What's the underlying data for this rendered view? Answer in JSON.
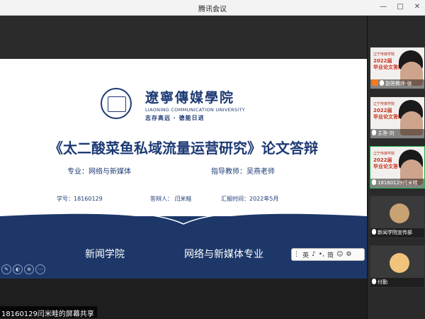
{
  "window": {
    "title": "腾讯会议",
    "controls": [
      "—",
      "□",
      "✕"
    ]
  },
  "slide": {
    "university_cn": "遼寧傳媒學院",
    "university_en": "LIAONING COMMUNICATION UNIVERSITY",
    "motto": "志存高远 · 德能日进",
    "thesis_title": "《太二酸菜鱼私域流量运营研究》论文答辩",
    "major": "专业：网络与新媒体",
    "advisor": "指导教师：吴燕老师",
    "student_id": "学号：18160129",
    "defender": "答辩人：   闫米畦",
    "report_time": "汇报时间：2022年5月",
    "college": "新闻学院",
    "department": "网络与新媒体专业"
  },
  "ime": {
    "items": [
      "英",
      "♪",
      "•,",
      "简",
      "☺",
      "⚙"
    ]
  },
  "share_caption": "18160129闫米畦的屏幕共享",
  "participants": [
    {
      "name": "副答教师-张",
      "poster_head": "辽宁传媒学院",
      "poster_lines": [
        "2022届",
        "毕业论文答辩"
      ]
    },
    {
      "name": "主答-刘",
      "poster_head": "辽宁传媒学院",
      "poster_lines": [
        "2022届",
        "毕业论文答辩"
      ]
    },
    {
      "name": "18160129闫米畦",
      "poster_head": "辽宁传媒学院",
      "poster_lines": [
        "2022届",
        "毕业论文答"
      ]
    },
    {
      "name": "新闻学院宣传部"
    },
    {
      "name": "付勤"
    }
  ],
  "colors": {
    "brand_blue": "#1d3a74",
    "speaking_green": "#23b14d",
    "host_orange": "#f27b21"
  }
}
